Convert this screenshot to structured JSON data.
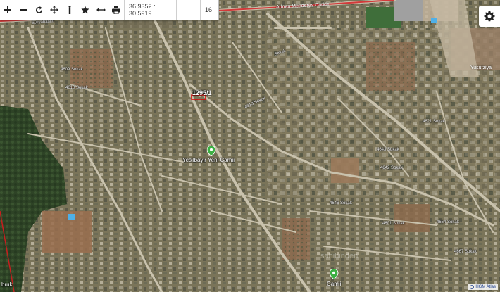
{
  "toolbar": {
    "coordinates": "36.9352 : 30.5919",
    "zoom": "16",
    "buttons": [
      "plus-icon",
      "minus-icon",
      "refresh-icon",
      "move-icon",
      "info-icon",
      "star-icon",
      "measure-icon",
      "print-icon"
    ]
  },
  "map": {
    "parcel_label": "1295/1",
    "poi_mosque_1": "Yesilbayir Yeni Camii",
    "poi_mosque_2": "Camii",
    "watermark": "sahibinden",
    "attribution": "HGM Atlas",
    "left_edge_label": "bruk",
    "streets": {
      "adnan_menderes": "Adnan Menderes Cadde",
      "yusufziya": "Yusufziya",
      "evliyahanim": "Evliyahanim",
      "s4609": "4609 Sokak",
      "s4610": "4610 Sokak",
      "s4613": "4613 Sokak",
      "s4643": "4643 Sokak",
      "s4642": "4642 Sokak",
      "s4646": "4646 Sokak",
      "s4664": "4664 Sokak",
      "s4667": "4667 Sokak",
      "s4601": "4601 Sokak",
      "s4621": "4621 Sokak",
      "sokak": "Sokak"
    }
  },
  "colors": {
    "highway_red": "#d23a3a",
    "pin_green": "#3cb043",
    "boundary_red": "#c81e1e"
  }
}
